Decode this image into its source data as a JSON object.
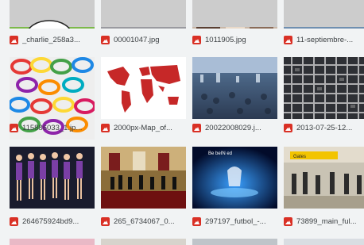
{
  "files": [
    {
      "name": "_charlie_258a3...",
      "thumb": "cartoon"
    },
    {
      "name": "00001047.jpg",
      "thumb": "street"
    },
    {
      "name": "1011905.jpg",
      "thumb": "people-blue"
    },
    {
      "name": "11-septiembre-...",
      "thumb": "city"
    },
    {
      "name": "115886033_1.jp...",
      "thumb": "colorful"
    },
    {
      "name": "2000px-Map_of...",
      "thumb": "map"
    },
    {
      "name": "20022008029.j...",
      "thumb": "crowd"
    },
    {
      "name": "2013-07-25-12...",
      "thumb": "pattern"
    },
    {
      "name": "264675924bd9...",
      "thumb": "dancers"
    },
    {
      "name": "265_6734067_0...",
      "thumb": "hall"
    },
    {
      "name": "297197_futbol_-...",
      "thumb": "trophy"
    },
    {
      "name": "73899_main_ful...",
      "thumb": "airport"
    }
  ],
  "bottom_row_thumbs": [
    "pink",
    "street-light",
    "gray",
    "gray-light"
  ],
  "trophy_caption": "Be beIN ed",
  "airport_sign": "Gates"
}
